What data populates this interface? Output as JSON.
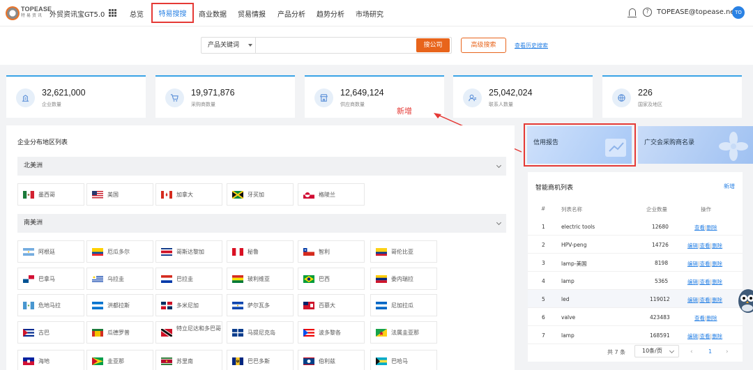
{
  "brand": {
    "logo_en": "TOPEASE",
    "logo_cn": "特易资讯",
    "app_name": "外贸资讯宝GT5.0"
  },
  "nav": {
    "items": [
      "总览",
      "特易搜搜",
      "商业数据",
      "贸易情报",
      "产品分析",
      "趋势分析",
      "市场研究"
    ],
    "active": "特易搜搜"
  },
  "user": {
    "email": "TOPEASE@topease.net",
    "avatar": "TO"
  },
  "search": {
    "type": "产品关键词",
    "value": "",
    "button": "搜公司",
    "advanced": "高级搜索",
    "history": "查看历史搜索"
  },
  "stats": [
    {
      "icon": "building-icon",
      "value": "32,621,000",
      "label": "企业数量"
    },
    {
      "icon": "cart-icon",
      "value": "19,971,876",
      "label": "采购商数量"
    },
    {
      "icon": "store-icon",
      "value": "12,649,124",
      "label": "供应商数量"
    },
    {
      "icon": "contact-icon",
      "value": "25,042,024",
      "label": "联系人数量"
    },
    {
      "icon": "globe-icon",
      "value": "226",
      "label": "国家及地区"
    }
  ],
  "annotation": {
    "new_label": "新增",
    "color": "#e53935"
  },
  "distribution": {
    "title": "企业分布地区列表",
    "regions": [
      {
        "name": "北美洲",
        "countries": [
          "墨西哥",
          "美国",
          "加拿大",
          "牙买加",
          "格陵兰"
        ]
      },
      {
        "name": "南美洲",
        "countries": [
          "阿根廷",
          "厄瓜多尔",
          "哥斯达黎加",
          "秘鲁",
          "智利",
          "哥伦比亚",
          "巴拿马",
          "乌拉圭",
          "巴拉圭",
          "玻利维亚",
          "巴西",
          "委内瑞拉",
          "危地马拉",
          "洪都拉斯",
          "多米尼加",
          "萨尔瓦多",
          "百慕大",
          "尼加拉瓜",
          "古巴",
          "瓜德罗普",
          "特立尼达和多巴哥",
          "马提尼克岛",
          "波多黎各",
          "法属圭亚那",
          "海地",
          "圭亚那",
          "苏里南",
          "巴巴多斯",
          "伯利兹",
          "巴哈马"
        ]
      }
    ]
  },
  "promos": [
    {
      "label": "信用报告"
    },
    {
      "label": "广交会采购商名录"
    }
  ],
  "opportunities": {
    "title": "智能商机列表",
    "add": "新增",
    "headers": [
      "#",
      "列表名称",
      "企业数量",
      "操作"
    ],
    "rows": [
      {
        "no": "1",
        "name": "electric tools",
        "count": "12680",
        "ops": [
          "查看",
          "删除"
        ]
      },
      {
        "no": "2",
        "name": "HPV-peng",
        "count": "14726",
        "ops": [
          "编辑",
          "查看",
          "删除"
        ]
      },
      {
        "no": "3",
        "name": "lamp-美国",
        "count": "8198",
        "ops": [
          "编辑",
          "查看",
          "删除"
        ]
      },
      {
        "no": "4",
        "name": "lamp",
        "count": "5365",
        "ops": [
          "编辑",
          "查看",
          "删除"
        ]
      },
      {
        "no": "5",
        "name": "led",
        "count": "119012",
        "ops": [
          "编辑",
          "查看",
          "删除"
        ]
      },
      {
        "no": "6",
        "name": "valve",
        "count": "423483",
        "ops": [
          "查看",
          "删除"
        ]
      },
      {
        "no": "7",
        "name": "lamp",
        "count": "168591",
        "ops": [
          "编辑",
          "查看",
          "删除"
        ]
      }
    ],
    "pager": {
      "total": "共 7 条",
      "page_size": "10条/页",
      "current": "1",
      "prev": "‹",
      "next": "›"
    }
  },
  "colors": {
    "accent": "#2a82e4",
    "brand_orange": "#e8641b",
    "highlight": "#e53935"
  }
}
